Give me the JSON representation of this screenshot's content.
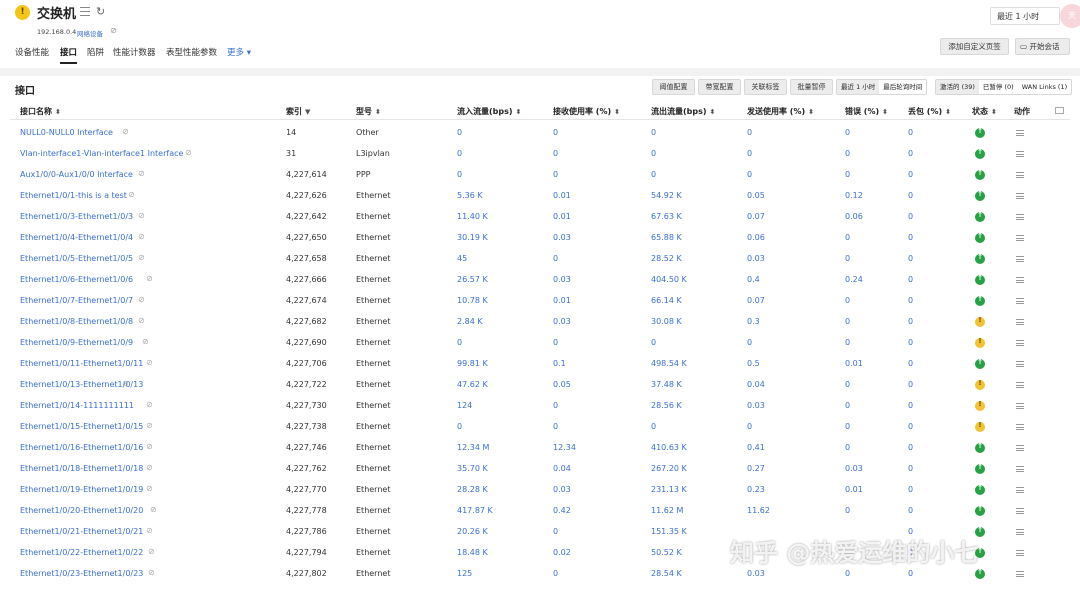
{
  "header": {
    "title": "交换机",
    "ip": "192.168.0.4",
    "device_type": "网络设备",
    "time_range": "最近 1 小时",
    "avatar_text": "天"
  },
  "tabs": [
    "设备性能",
    "接口",
    "陷阱",
    "性能计数器",
    "表型性能参数",
    "更多 ▾"
  ],
  "actions": {
    "custom_page": "添加自定义页签",
    "chat": "开始会话"
  },
  "section": {
    "title": "接口",
    "toolbar": [
      "阈值配置",
      "带宽配置",
      "关联标签",
      "批量暂停"
    ],
    "time_group": [
      "最近 1 小时",
      "最后轮询时间"
    ],
    "filter_group": [
      "激活的 (39)",
      "已暂停 (0)",
      "WAN Links (1)"
    ]
  },
  "columns": [
    "接口名称",
    "索引",
    "型号",
    "流入流量(bps)",
    "接收使用率 (%)",
    "流出流量(bps)",
    "发送使用率 (%)",
    "错误 (%)",
    "丢包 (%)",
    "状态",
    "动作"
  ],
  "rows": [
    {
      "name": "NULL0-NULL0 Interface",
      "index": "14",
      "type": "Other",
      "in": "0",
      "rx": "0",
      "out": "0",
      "tx": "0",
      "err": "0",
      "drop": "0",
      "status": "up"
    },
    {
      "name": "Vlan-interface1-Vlan-interface1 Interface",
      "index": "31",
      "type": "L3ipvlan",
      "in": "0",
      "rx": "0",
      "out": "0",
      "tx": "0",
      "err": "0",
      "drop": "0",
      "status": "up"
    },
    {
      "name": "Aux1/0/0-Aux1/0/0 Interface",
      "index": "4,227,614",
      "type": "PPP",
      "in": "0",
      "rx": "0",
      "out": "0",
      "tx": "0",
      "err": "0",
      "drop": "0",
      "status": "up"
    },
    {
      "name": "Ethernet1/0/1-this is a test",
      "index": "4,227,626",
      "type": "Ethernet",
      "in": "5.36 K",
      "rx": "0.01",
      "out": "54.92 K",
      "tx": "0.05",
      "err": "0.12",
      "drop": "0",
      "status": "up"
    },
    {
      "name": "Ethernet1/0/3-Ethernet1/0/3",
      "index": "4,227,642",
      "type": "Ethernet",
      "in": "11.40 K",
      "rx": "0.01",
      "out": "67.63 K",
      "tx": "0.07",
      "err": "0.06",
      "drop": "0",
      "status": "up"
    },
    {
      "name": "Ethernet1/0/4-Ethernet1/0/4",
      "index": "4,227,650",
      "type": "Ethernet",
      "in": "30.19 K",
      "rx": "0.03",
      "out": "65.88 K",
      "tx": "0.06",
      "err": "0",
      "drop": "0",
      "status": "up"
    },
    {
      "name": "Ethernet1/0/5-Ethernet1/0/5",
      "index": "4,227,658",
      "type": "Ethernet",
      "in": "45",
      "rx": "0",
      "out": "28.52 K",
      "tx": "0.03",
      "err": "0",
      "drop": "0",
      "status": "up"
    },
    {
      "name": "Ethernet1/0/6-Ethernet1/0/6",
      "index": "4,227,666",
      "type": "Ethernet",
      "in": "26.57 K",
      "rx": "0.03",
      "out": "404.50 K",
      "tx": "0.4",
      "err": "0.24",
      "drop": "0",
      "status": "up"
    },
    {
      "name": "Ethernet1/0/7-Ethernet1/0/7",
      "index": "4,227,674",
      "type": "Ethernet",
      "in": "10.78 K",
      "rx": "0.01",
      "out": "66.14 K",
      "tx": "0.07",
      "err": "0",
      "drop": "0",
      "status": "up"
    },
    {
      "name": "Ethernet1/0/8-Ethernet1/0/8",
      "index": "4,227,682",
      "type": "Ethernet",
      "in": "2.84 K",
      "rx": "0.03",
      "out": "30.08 K",
      "tx": "0.3",
      "err": "0",
      "drop": "0",
      "status": "up"
    },
    {
      "name": "Ethernet1/0/9-Ethernet1/0/9",
      "index": "4,227,690",
      "type": "Ethernet",
      "in": "0",
      "rx": "0",
      "out": "0",
      "tx": "0",
      "err": "0",
      "drop": "0",
      "status": "warn"
    },
    {
      "name": "Ethernet1/0/11-Ethernet1/0/11",
      "index": "4,227,706",
      "type": "Ethernet",
      "in": "99.81 K",
      "rx": "0.1",
      "out": "498.54 K",
      "tx": "0.5",
      "err": "0.01",
      "drop": "0",
      "status": "warn"
    },
    {
      "name": "Ethernet1/0/13-Ethernet1/0/13",
      "index": "4,227,722",
      "type": "Ethernet",
      "in": "47.62 K",
      "rx": "0.05",
      "out": "37.48 K",
      "tx": "0.04",
      "err": "0",
      "drop": "0",
      "status": "up"
    },
    {
      "name": "Ethernet1/0/14-1111111111",
      "index": "4,227,730",
      "type": "Ethernet",
      "in": "124",
      "rx": "0",
      "out": "28.56 K",
      "tx": "0.03",
      "err": "0",
      "drop": "0",
      "status": "warn"
    },
    {
      "name": "Ethernet1/0/15-Ethernet1/0/15",
      "index": "4,227,738",
      "type": "Ethernet",
      "in": "0",
      "rx": "0",
      "out": "0",
      "tx": "0",
      "err": "0",
      "drop": "0",
      "status": "warn"
    },
    {
      "name": "Ethernet1/0/16-Ethernet1/0/16",
      "index": "4,227,746",
      "type": "Ethernet",
      "in": "12.34 M",
      "rx": "12.34",
      "out": "410.63 K",
      "tx": "0.41",
      "err": "0",
      "drop": "0",
      "status": "up"
    },
    {
      "name": "Ethernet1/0/18-Ethernet1/0/18",
      "index": "4,227,762",
      "type": "Ethernet",
      "in": "35.70 K",
      "rx": "0.04",
      "out": "267.20 K",
      "tx": "0.27",
      "err": "0.03",
      "drop": "0",
      "status": "up"
    },
    {
      "name": "Ethernet1/0/19-Ethernet1/0/19",
      "index": "4,227,770",
      "type": "Ethernet",
      "in": "28.28 K",
      "rx": "0.03",
      "out": "231.13 K",
      "tx": "0.23",
      "err": "0.01",
      "drop": "0",
      "status": "up"
    },
    {
      "name": "Ethernet1/0/20-Ethernet1/0/20",
      "index": "4,227,778",
      "type": "Ethernet",
      "in": "417.87 K",
      "rx": "0.42",
      "out": "11.62 M",
      "tx": "11.62",
      "err": "0",
      "drop": "0",
      "status": "up"
    },
    {
      "name": "Ethernet1/0/21-Ethernet1/0/21",
      "index": "4,227,786",
      "type": "Ethernet",
      "in": "20.26 K",
      "rx": "0",
      "out": "151.35 K",
      "tx": "",
      "err": "",
      "drop": "0",
      "status": "up"
    },
    {
      "name": "Ethernet1/0/22-Ethernet1/0/22",
      "index": "4,227,794",
      "type": "Ethernet",
      "in": "18.48 K",
      "rx": "0.02",
      "out": "50.52 K",
      "tx": "",
      "err": "",
      "drop": "0",
      "status": "up"
    },
    {
      "name": "Ethernet1/0/23-Ethernet1/0/23",
      "index": "4,227,802",
      "type": "Ethernet",
      "in": "125",
      "rx": "0",
      "out": "28.54 K",
      "tx": "0.03",
      "err": "0",
      "drop": "0",
      "status": "up"
    }
  ],
  "watermark": "知乎 @热爱运维的小七",
  "colors": {
    "accent": "#3b6fd4",
    "status_up": "#25a244",
    "status_warn": "#f2c230"
  }
}
